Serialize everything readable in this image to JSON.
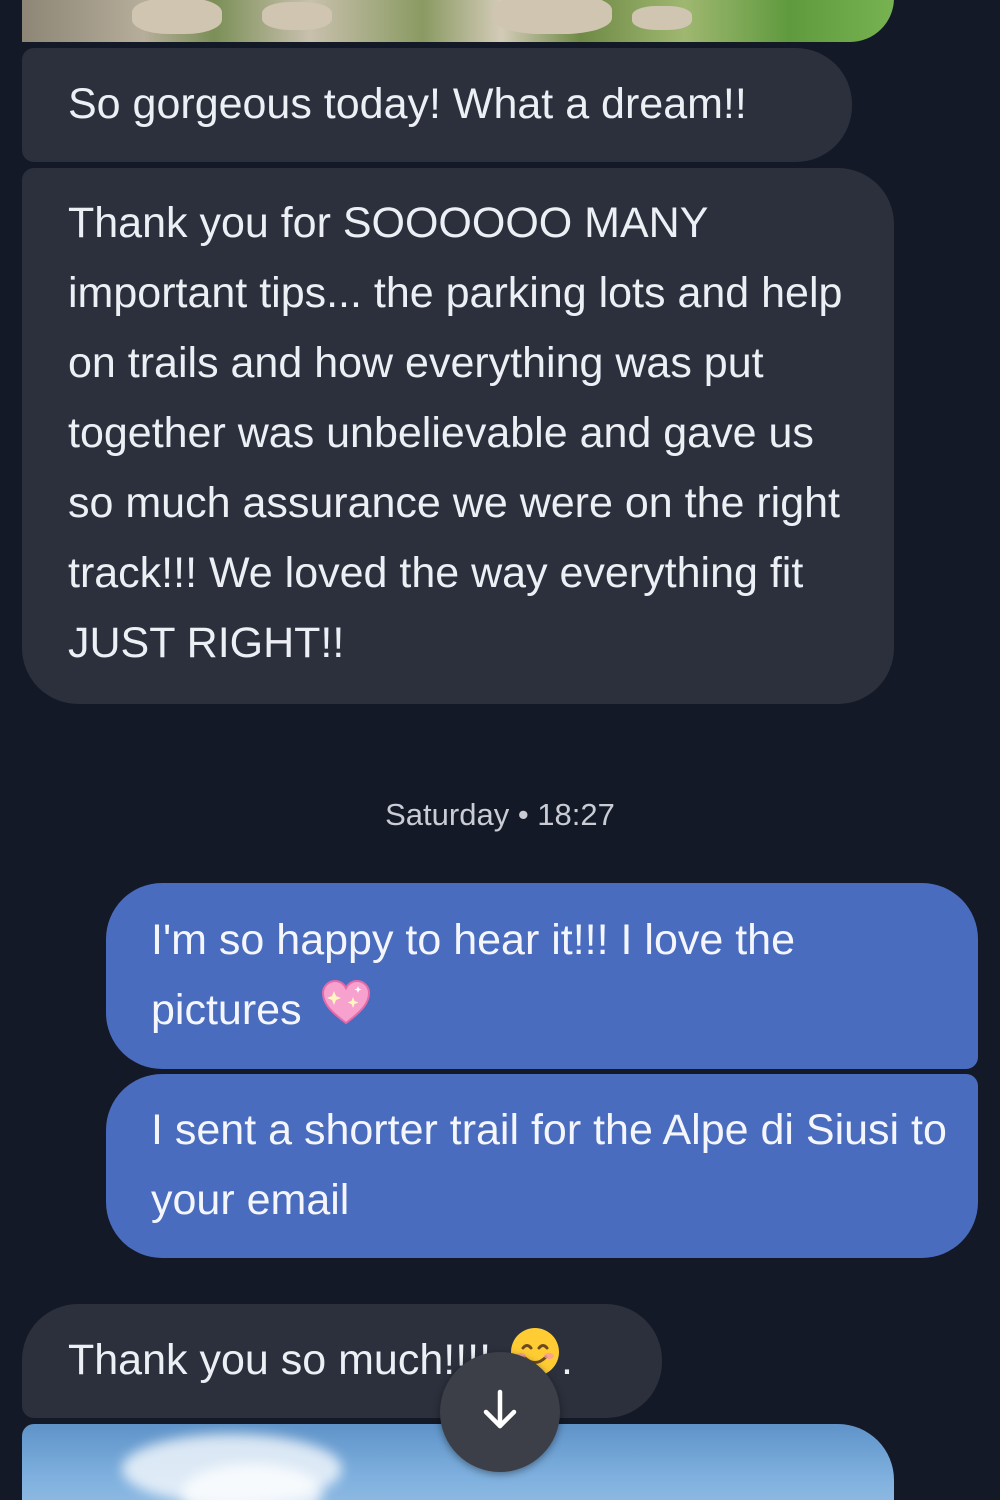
{
  "messages": [
    {
      "direction": "incoming",
      "text": "So gorgeous today! What a dream!!"
    },
    {
      "direction": "incoming",
      "text": "Thank you for SOOOOOO MANY important tips... the parking lots and help on trails and how everything was put together was unbelievable and gave us so much assurance we were on the right track!!! We loved the way everything fit JUST RIGHT!!"
    },
    {
      "direction": "outgoing",
      "text": "I'm so happy to hear it!!! I love the pictures",
      "emoji": "sparkling-heart-emoji"
    },
    {
      "direction": "outgoing",
      "text": "I sent a shorter trail for the Alpe di Siusi to your email"
    },
    {
      "direction": "incoming",
      "text": "Thank you so much!!!!",
      "emoji": "smiling-face-emoji",
      "suffix": "."
    }
  ],
  "timestamp": "Saturday • 18:27",
  "icons": {
    "scroll_down": "arrow-down-icon"
  },
  "colors": {
    "background": "#141927",
    "incoming_bubble": "#2c303d",
    "outgoing_bubble": "#4a6cbe"
  }
}
